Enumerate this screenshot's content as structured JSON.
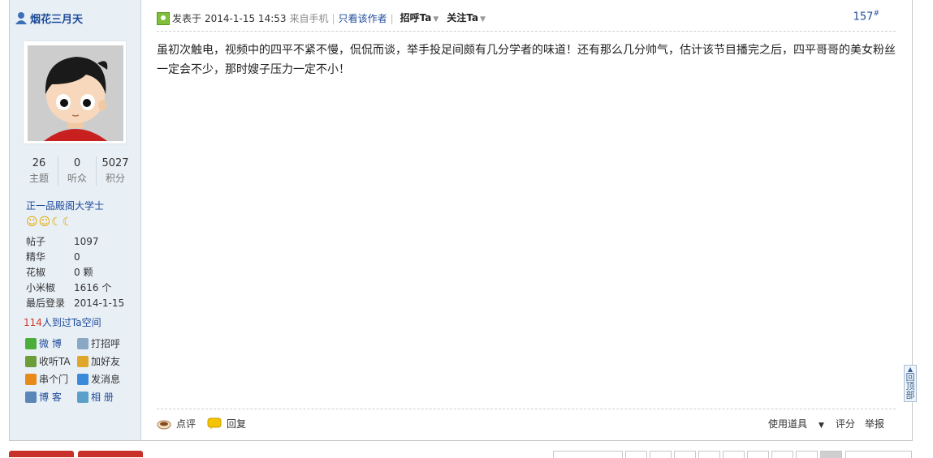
{
  "user": {
    "name": "烟花三月天",
    "stats": [
      {
        "num": "26",
        "label": "主题"
      },
      {
        "num": "0",
        "label": "听众"
      },
      {
        "num": "5027",
        "label": "积分"
      }
    ],
    "rank": "正一品殿阁大学士",
    "medals": [
      "☺",
      "☺",
      "☾",
      "☾"
    ],
    "info": [
      {
        "key": "帖子",
        "value": "1097"
      },
      {
        "key": "精华",
        "value": "0"
      },
      {
        "key": "花椒",
        "value": "0 颗"
      },
      {
        "key": "小米椒",
        "value": "1616 个"
      },
      {
        "key": "最后登录",
        "value": "2014-1-15"
      }
    ],
    "visits_count": "114",
    "visits_text": "人到过Ta空间",
    "actions": [
      {
        "label": "微 博",
        "icon": "weibo-icon",
        "color": "#4cae3a"
      },
      {
        "label": "打招呼",
        "icon": "wave-icon",
        "color": "#8aa7c4"
      },
      {
        "label": "收听TA",
        "icon": "listen-icon",
        "color": "#6c9d3a"
      },
      {
        "label": "加好友",
        "icon": "add-friend-icon",
        "color": "#e0a62a"
      },
      {
        "label": "串个门",
        "icon": "home-icon",
        "color": "#e88a1a"
      },
      {
        "label": "发消息",
        "icon": "message-icon",
        "color": "#3b8ad9"
      },
      {
        "label": "博 客",
        "icon": "blog-icon",
        "color": "#5b86b8"
      },
      {
        "label": "相 册",
        "icon": "album-icon",
        "color": "#5aa0c8"
      }
    ]
  },
  "post": {
    "posted_label": "发表于",
    "time": "2014-1-15 14:53",
    "source": "来自手机",
    "only_author": "只看该作者",
    "greet": "招呼Ta",
    "follow": "关注Ta",
    "floor": "157",
    "floor_mark": "#",
    "content": "虽初次触电，视频中的四平不紧不慢，侃侃而谈，举手投足间颇有几分学者的味道！还有那么几分帅气，估计该节目播完之后，四平哥哥的美女粉丝一定会不少，那时嫂子压力一定不小！",
    "footer": {
      "comment": "点评",
      "reply": "回复",
      "tools": "使用道具",
      "rate": "评分",
      "report": "举报"
    }
  },
  "back_to_top": "回顶部"
}
